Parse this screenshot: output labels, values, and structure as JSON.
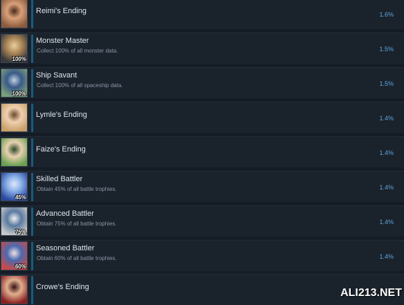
{
  "achievements": [
    {
      "title": "Reimi's Ending",
      "description": "",
      "rarity": "1.6%",
      "badge": "",
      "icon": "reimi-portrait",
      "icon_colors": [
        "#8a5a3c",
        "#d9a07a",
        "#4a2a1a"
      ]
    },
    {
      "title": "Monster Master",
      "description": "Collect 100% of all monster data.",
      "rarity": "1.5%",
      "badge": "100%",
      "icon": "monster-claw",
      "icon_colors": [
        "#3a3a3a",
        "#b08a5a",
        "#e8d0a0"
      ]
    },
    {
      "title": "Ship Savant",
      "description": "Collect 100% of all spaceship data.",
      "rarity": "1.5%",
      "badge": "100%",
      "icon": "spaceship",
      "icon_colors": [
        "#7aa07a",
        "#3a5a8a",
        "#c0d0e0"
      ]
    },
    {
      "title": "Lymle's Ending",
      "description": "",
      "rarity": "1.4%",
      "badge": "",
      "icon": "lymle-portrait",
      "icon_colors": [
        "#c9a06a",
        "#f0d0b0",
        "#6a4a2a"
      ]
    },
    {
      "title": "Faize's Ending",
      "description": "",
      "rarity": "1.4%",
      "badge": "",
      "icon": "faize-portrait",
      "icon_colors": [
        "#6aa050",
        "#e8d0b0",
        "#2a4a2a"
      ]
    },
    {
      "title": "Skilled Battler",
      "description": "Obtain 45% of all battle trophies.",
      "rarity": "1.4%",
      "badge": "45%",
      "icon": "battle-trophy",
      "icon_colors": [
        "#2a4aa0",
        "#8ab0e8",
        "#e0e8f8"
      ]
    },
    {
      "title": "Advanced Battler",
      "description": "Obtain 75% of all battle trophies.",
      "rarity": "1.4%",
      "badge": "75%",
      "icon": "battle-trophy",
      "icon_colors": [
        "#c8c8c8",
        "#5a7aa0",
        "#f0f0f0"
      ]
    },
    {
      "title": "Seasoned Battler",
      "description": "Obtain 60% of all battle trophies.",
      "rarity": "1.4%",
      "badge": "60%",
      "icon": "battle-trophy",
      "icon_colors": [
        "#c84a4a",
        "#4a6ab0",
        "#f0e0e0"
      ]
    },
    {
      "title": "Crowe's Ending",
      "description": "",
      "rarity": "",
      "badge": "",
      "icon": "crowe-portrait",
      "icon_colors": [
        "#8a2020",
        "#e0b090",
        "#3a1010"
      ]
    }
  ],
  "watermark": "ALI213.NET"
}
